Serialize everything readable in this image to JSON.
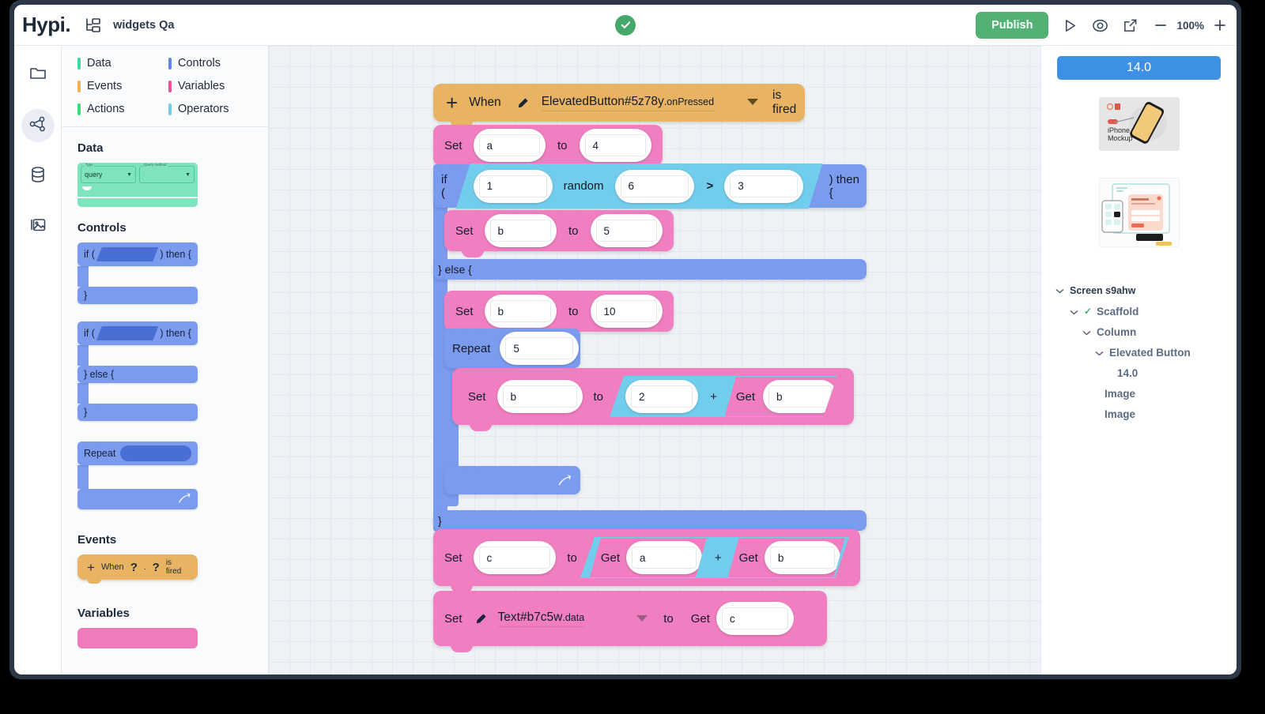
{
  "header": {
    "logo": "Hypi.",
    "project_icon": "project-tree-icon",
    "project_name": "widgets Qa",
    "status_icon": "check-circle-icon",
    "publish_label": "Publish",
    "run_icon": "play-icon",
    "preview_icon": "eye-icon",
    "open_external_icon": "external-link-icon",
    "zoom_out_icon": "minus-icon",
    "zoom_level": "100%",
    "zoom_in_icon": "plus-icon"
  },
  "rail": {
    "items": [
      {
        "icon": "folder-icon",
        "active": false
      },
      {
        "icon": "share-nodes-icon",
        "active": true
      },
      {
        "icon": "database-icon",
        "active": false
      },
      {
        "icon": "image-icon",
        "active": false
      }
    ]
  },
  "palette": {
    "categories": [
      {
        "label": "Data",
        "color": "#3ddba0"
      },
      {
        "label": "Controls",
        "color": "#5f85e8"
      },
      {
        "label": "Events",
        "color": "#eeb252"
      },
      {
        "label": "Variables",
        "color": "#ef4f9c"
      },
      {
        "label": "Actions",
        "color": "#3ddb7c"
      },
      {
        "label": "Operators",
        "color": "#72cdec"
      }
    ],
    "sections": {
      "data": {
        "title": "Data",
        "query_block": {
          "type_label": "Type",
          "type_value": "query",
          "method_label": "Query method",
          "method_value": ""
        }
      },
      "controls": {
        "title": "Controls",
        "if_then": {
          "if_label": "if (",
          "then_label": ") then {",
          "close_label": "}"
        },
        "if_else": {
          "if_label": "if (",
          "then_label": ") then {",
          "else_label": "} else {",
          "close_label": "}"
        },
        "repeat": {
          "label": "Repeat",
          "arrow_icon": "loop-arrow-icon"
        }
      },
      "events": {
        "title": "Events",
        "when_block": {
          "plus": "+",
          "when": "When",
          "q1": "?",
          "dot": ".",
          "q2": "?",
          "fired": "is fired"
        }
      },
      "variables": {
        "title": "Variables"
      }
    }
  },
  "canvas": {
    "when_block": {
      "plus": "+",
      "when_label": "When",
      "edit_icon": "pencil-icon",
      "target": "ElevatedButton#5z78y",
      "target_suffix": ".onPressed",
      "dropdown_icon": "chevron-down-icon",
      "fired_label": "is fired"
    },
    "rows": [
      {
        "kind": "set",
        "set_label": "Set",
        "var": "a",
        "to_label": "to",
        "value": "4"
      },
      {
        "kind": "if",
        "if_label": "if (",
        "then_label": ") then {",
        "operand_left": "1",
        "operator_mid": "random",
        "operand_mid": "6",
        "comparator": ">",
        "operand_right": "3"
      },
      {
        "kind": "set",
        "set_label": "Set",
        "var": "b",
        "to_label": "to",
        "value": "5"
      },
      {
        "kind": "else",
        "else_label": "} else {"
      },
      {
        "kind": "set",
        "set_label": "Set",
        "var": "b",
        "to_label": "to",
        "value": "10"
      },
      {
        "kind": "repeat",
        "repeat_label": "Repeat",
        "count": "5",
        "arrow_icon": "loop-arrow-icon"
      },
      {
        "kind": "set_expr",
        "set_label": "Set",
        "var": "b",
        "to_label": "to",
        "left": "2",
        "op": "+",
        "get_label": "Get",
        "right": "b"
      },
      {
        "kind": "close",
        "close_label": "}"
      },
      {
        "kind": "set_expr2",
        "set_label": "Set",
        "var": "c",
        "to_label": "to",
        "get_label_a": "Get",
        "left": "a",
        "op": "+",
        "get_label_b": "Get",
        "right": "b"
      },
      {
        "kind": "set_widget",
        "set_label": "Set",
        "edit_icon": "pencil-icon",
        "target": "Text#b7c5w",
        "target_suffix": ".data",
        "dropdown_icon": "chevron-down-icon",
        "to_label": "to",
        "get_label": "Get",
        "value": "c"
      }
    ]
  },
  "right_panel": {
    "version_badge": "14.0",
    "thumbnails": [
      {
        "name": "iphone-mockup-thumbnail",
        "caption": "iPhone Mockup"
      },
      {
        "name": "ui-kit-thumbnail",
        "caption": ""
      }
    ],
    "tree": [
      {
        "label": "Screen s9ahw",
        "depth": 0,
        "chevron": true,
        "check": false
      },
      {
        "label": "Scaffold",
        "depth": 1,
        "chevron": true,
        "check": true
      },
      {
        "label": "Column",
        "depth": 2,
        "chevron": true,
        "check": false
      },
      {
        "label": "Elevated Button",
        "depth": 3,
        "chevron": true,
        "check": false
      },
      {
        "label": "14.0",
        "depth": 4,
        "chevron": false,
        "check": false
      },
      {
        "label": "Image",
        "depth": 3,
        "chevron": false,
        "check": false
      },
      {
        "label": "Image",
        "depth": 3,
        "chevron": false,
        "check": false
      }
    ]
  }
}
